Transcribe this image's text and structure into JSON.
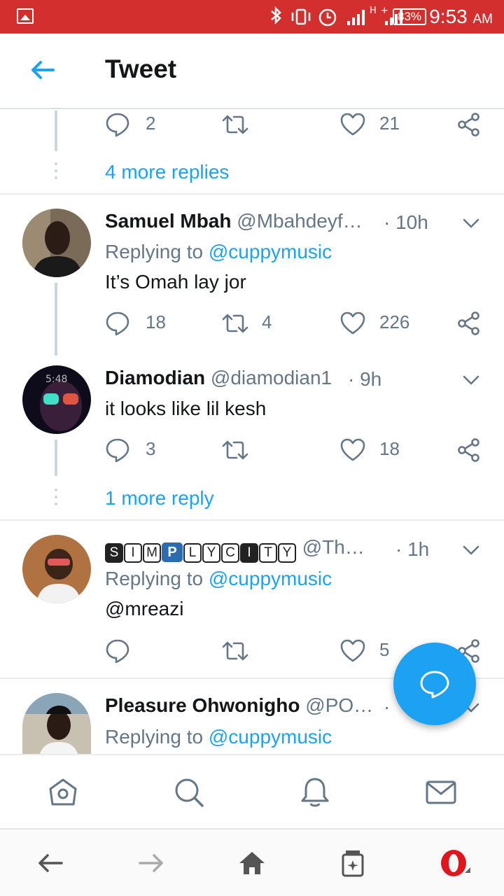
{
  "status_bar": {
    "battery": "83%",
    "time": "9:53",
    "ampm": "AM",
    "icons": "✱▯⏰"
  },
  "header": {
    "title": "Tweet"
  },
  "thread_top": {
    "reply_count": "2",
    "retweet_count": "",
    "like_count": "21",
    "more_replies": "4 more replies"
  },
  "tweets": [
    {
      "name": "Samuel Mbah",
      "handle": "@Mbahdeyf…",
      "time": "· 10h",
      "replying_prefix": "Replying to ",
      "replying_to": "@cuppymusic",
      "text": "It’s Omah lay jor",
      "reply_count": "18",
      "retweet_count": "4",
      "like_count": "226"
    },
    {
      "name": "Diamodian",
      "handle": "@diamodian1",
      "time": "· 9h",
      "text": "it looks like lil kesh",
      "reply_count": "3",
      "retweet_count": "",
      "like_count": "18",
      "more_replies": "1 more reply",
      "avatar_clock": "5:48"
    },
    {
      "name_letters": [
        "S",
        "I",
        "M",
        "P",
        "L",
        "Y",
        "C",
        "I",
        "T",
        "Y"
      ],
      "handle": "@Th…",
      "time": "· 1h",
      "replying_prefix": "Replying to ",
      "replying_to": "@cuppymusic",
      "text": "@mreazi",
      "reply_count": "",
      "retweet_count": "",
      "like_count": "5"
    },
    {
      "name": "Pleasure Ohwonigho",
      "handle": "@PO…",
      "time": "· ",
      "replying_prefix": "Replying to ",
      "replying_to": "@cuppymusic"
    }
  ],
  "colors": {
    "accent": "#1da1f2",
    "status_bar": "#d32f2f"
  }
}
